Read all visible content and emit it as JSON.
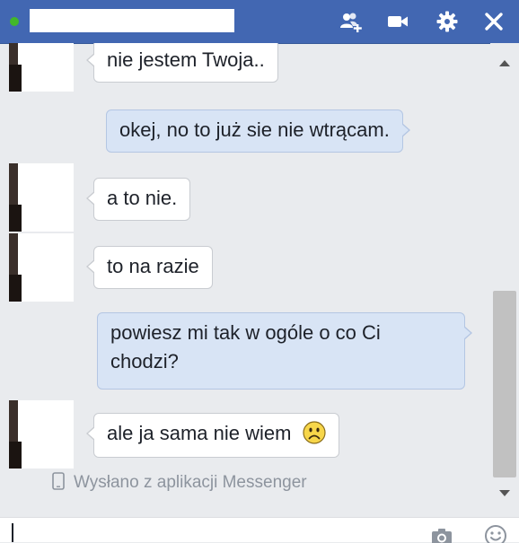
{
  "header": {
    "contact_name": "",
    "icons": [
      "add-friend-icon",
      "video-call-icon",
      "gear-icon",
      "close-icon"
    ],
    "color": "#4267b2"
  },
  "messages": [
    {
      "from": "them",
      "text": "nie jestem Twoja.."
    },
    {
      "from": "me",
      "text": "okej, no to już sie nie wtrącam."
    },
    {
      "from": "them",
      "text": "a to nie."
    },
    {
      "from": "them",
      "text": "to na razie"
    },
    {
      "from": "me",
      "text": "powiesz mi tak w ogóle o co Ci chodzi?"
    },
    {
      "from": "them",
      "text": "ale ja sama nie wiem",
      "emoji": "sad-face-icon"
    }
  ],
  "sent_from": {
    "text": "Wysłano z aplikacji Messenger",
    "icon": "phone-icon"
  },
  "composer": {
    "value": "",
    "placeholder": "",
    "icons": [
      "camera-icon",
      "emoji-icon"
    ]
  }
}
